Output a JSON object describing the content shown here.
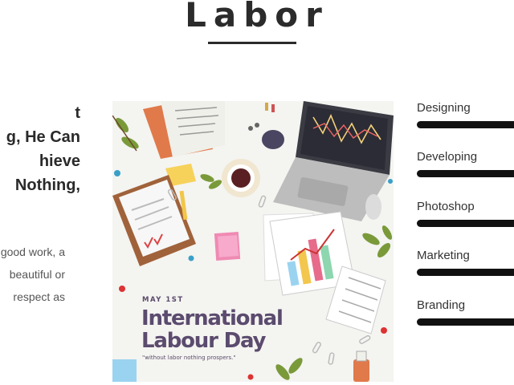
{
  "page": {
    "title": "Labor"
  },
  "headline": {
    "lines": [
      "t",
      "g, He Can",
      "hieve",
      " Nothing,"
    ]
  },
  "body": {
    "lines": [
      "good work, a",
      "beautiful or",
      "respect as"
    ]
  },
  "poster": {
    "date": "MAY 1ST",
    "title_line1": "International",
    "title_line2": "Labour Day",
    "quote": "\"without labor nothing prospers.\""
  },
  "skills": [
    {
      "label": "Designing",
      "level": 1.0
    },
    {
      "label": "Developing",
      "level": 1.0
    },
    {
      "label": "Photoshop",
      "level": 1.0
    },
    {
      "label": "Marketing",
      "level": 1.0
    },
    {
      "label": "Branding",
      "level": 1.0
    }
  ]
}
